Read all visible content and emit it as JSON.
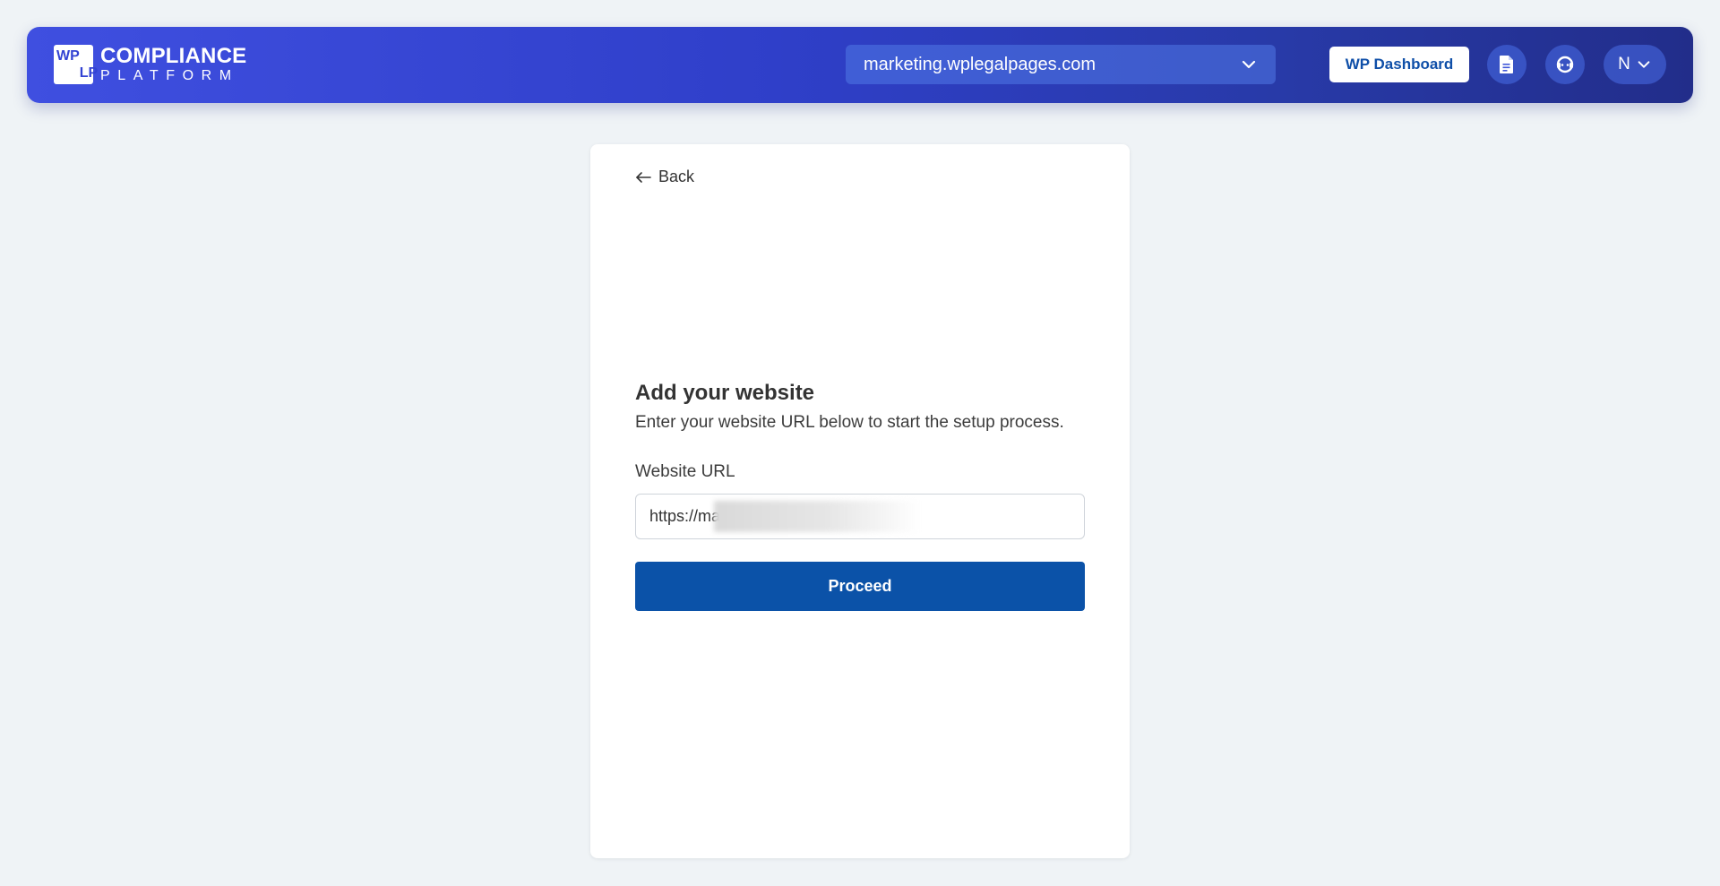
{
  "header": {
    "logo": {
      "mark_letters": [
        "WP",
        "LP"
      ],
      "line1": "COMPLIANCE",
      "line2": "PLATFORM"
    },
    "site_selector": {
      "value": "marketing.wplegalpages.com",
      "icon": "chevron-down-icon"
    },
    "wp_dashboard_label": "WP Dashboard",
    "icons": [
      "document-icon",
      "support-icon"
    ],
    "user": {
      "initial": "N",
      "icon": "chevron-down-icon"
    }
  },
  "card": {
    "back_label": "Back",
    "title": "Add your website",
    "subtitle": "Enter your website URL below to start the setup process.",
    "url_label": "Website URL",
    "url_value": "https://ma",
    "proceed_label": "Proceed"
  },
  "colors": {
    "header_gradient_start": "#3f4fe0",
    "header_gradient_end": "#222d8a",
    "primary_button": "#0b52a8",
    "page_background": "#eff3f6"
  }
}
